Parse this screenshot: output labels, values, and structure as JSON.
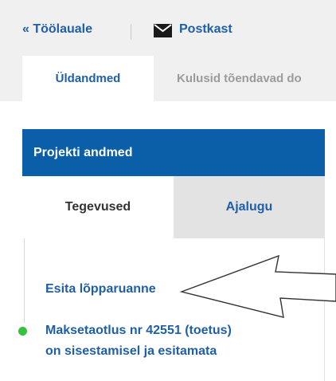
{
  "header": {
    "back_link_label": "« Töölauale",
    "mailbox_label": "Postkast",
    "mailbox_icon": "envelope-icon"
  },
  "tabs": [
    {
      "label": "Üldandmed",
      "active": true
    },
    {
      "label": "Kulusid tõendavad do",
      "active": false
    }
  ],
  "panel": {
    "title": "Projekti andmed",
    "subtabs": [
      {
        "label": "Tegevused",
        "active": true
      },
      {
        "label": "Ajalugu",
        "active": false
      }
    ],
    "action_link": "Esita lõpparuanne",
    "event": {
      "line1": "Maksetaotlus nr 42551 (toetus)",
      "line2": "on sisestamisel ja esitamata",
      "status_color": "#35c13b"
    }
  },
  "annotation": {
    "icon": "arrow-pointer-icon"
  },
  "colors": {
    "link": "#1f5fa8",
    "panel_header": "#0b5ea8",
    "top_bar": "#f0f0f0"
  }
}
